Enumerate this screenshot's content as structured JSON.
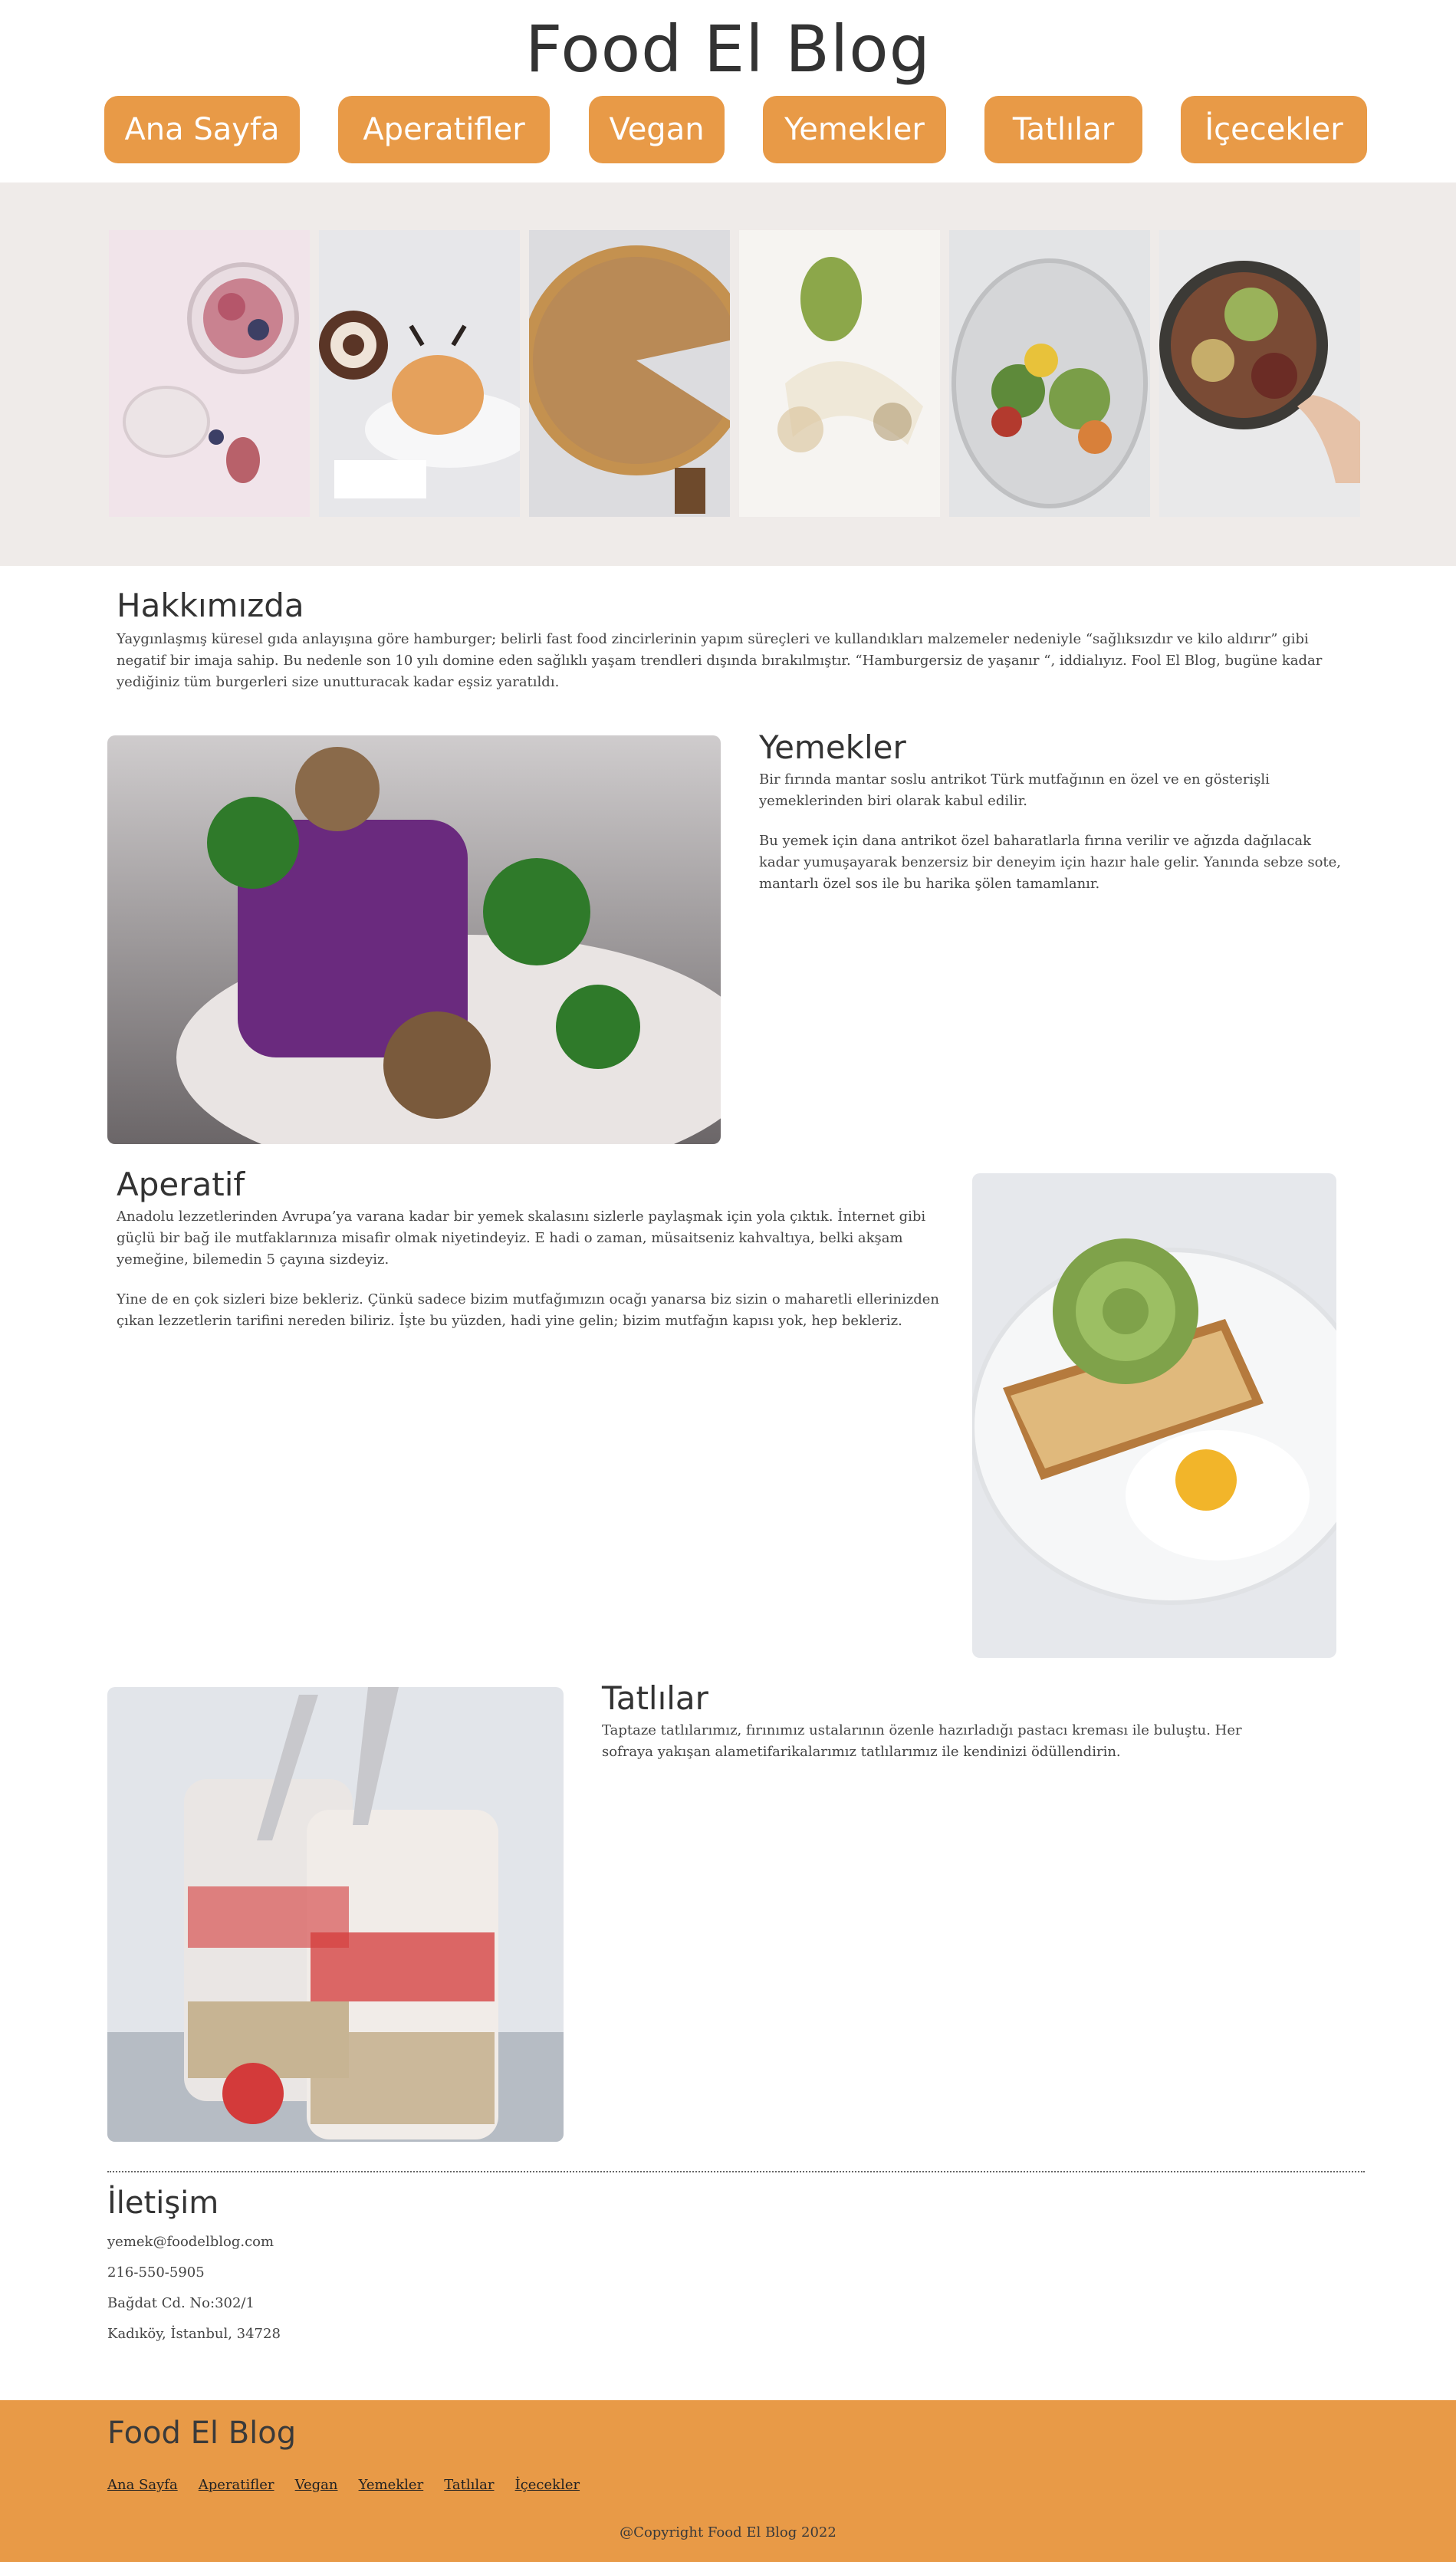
{
  "header": {
    "title": "Food El Blog",
    "nav": [
      "Ana Sayfa",
      "Aperatifler",
      "Vegan",
      "Yemekler",
      "Tatlılar",
      "İçecekler"
    ]
  },
  "about": {
    "title": "Hakkımızda",
    "text": "Yaygınlaşmış küresel gıda anlayışına göre hamburger; belirli fast food zincirlerinin yapım süreçleri ve kullandıkları malzemeler nedeniyle “sağlıksızdır ve kilo aldırır” gibi negatif bir imaja sahip. Bu nedenle son 10 yılı domine eden sağlıklı yaşam trendleri dışında bırakılmıştır. “Hamburgersiz de yaşanır “, iddialıyız. Fool El Blog, bugüne kadar yediğiniz tüm burgerleri size unutturacak kadar eşsiz yaratıldı."
  },
  "yemekler": {
    "title": "Yemekler",
    "p1": "Bir fırında mantar soslu antrikot Türk mutfağının en özel ve en gösterişli yemeklerinden biri olarak kabul edilir.",
    "p2": "Bu yemek için dana antrikot özel baharatlarla fırına verilir ve ağızda dağılacak kadar yumuşayarak benzersiz bir deneyim için hazır hale gelir. Yanında sebze sote, mantarlı özel sos ile bu harika şölen tamamlanır."
  },
  "aperatif": {
    "title": "Aperatif",
    "p1": "Anadolu lezzetlerinden Avrupa’ya varana kadar bir yemek skalasını sizlerle paylaşmak için yola çıktık. İnternet gibi güçlü bir bağ ile mutfaklarınıza misafir olmak niyetindeyiz. E hadi o zaman, müsaitseniz kahvaltıya, belki akşam yemeğine, bilemedin 5 çayına sizdeyiz.",
    "p2": "Yine de en çok sizleri bize bekleriz. Çünkü sadece bizim mutfağımızın ocağı yanarsa biz sizin o maharetli ellerinizden çıkan lezzetlerin tarifini nereden biliriz. İşte bu yüzden, hadi yine gelin; bizim mutfağın kapısı yok, hep bekleriz."
  },
  "tatlilar": {
    "title": "Tatlılar",
    "p1": "Taptaze tatlılarımız, fırınımız ustalarının özenle hazırladığı pastacı kreması ile buluştu. Her sofraya yakışan alametifarikalarımız tatlılarımız ile kendinizi ödüllendirin."
  },
  "contact": {
    "title": "İletişim",
    "email": "yemek@foodelblog.com",
    "phone": "216-550-5905",
    "address1": "Bağdat Cd. No:302/1",
    "address2": "Kadıköy, İstanbul, 34728"
  },
  "footer": {
    "title": "Food El Blog",
    "links": [
      "Ana Sayfa",
      "Aperatifler",
      "Vegan",
      "Yemekler",
      "Tatlılar",
      "İçecekler"
    ],
    "copyright": "@Copyright Food El Blog 2022"
  },
  "colors": {
    "accent": "#e89a47",
    "band": "#efebe9",
    "text": "#3d3d3d"
  }
}
